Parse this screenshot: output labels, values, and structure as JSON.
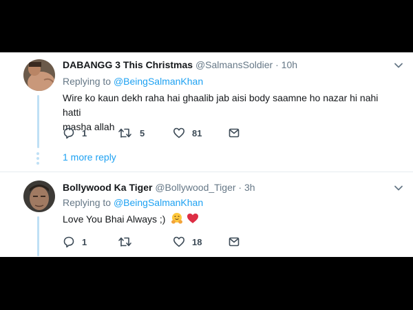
{
  "tweets": [
    {
      "name": "DABANGG 3 This Christmas",
      "handle": "@SalmansSoldier",
      "separator": "·",
      "time": "10h",
      "replying_prefix": "Replying to",
      "replying_to": "@BeingSalmanKhan",
      "text_line1": "Wire ko kaun dekh raha hai ghaalib jab aisi body saamne ho nazar hi nahi hatti",
      "text_line2": "masha allah",
      "replies": "1",
      "retweets": "5",
      "likes": "81",
      "more_replies": "1 more reply",
      "icons": [
        "chevron-down-icon",
        "reply-icon",
        "retweet-icon",
        "like-icon",
        "share-icon"
      ]
    },
    {
      "name": "Bollywood Ka Tiger",
      "handle": "@Bollywood_Tiger",
      "separator": "·",
      "time": "3h",
      "replying_prefix": "Replying to",
      "replying_to": "@BeingSalmanKhan",
      "text": "Love You Bhai Always ;)",
      "replies": "1",
      "retweets": "",
      "likes": "18",
      "icons": [
        "chevron-down-icon",
        "reply-icon",
        "retweet-icon",
        "like-icon",
        "share-icon",
        "hugging-face-emoji",
        "red-heart-emoji"
      ]
    }
  ],
  "colors": {
    "link": "#1da1f2",
    "muted": "#657786",
    "thread_line": "#bfe0f5",
    "background": "#000000",
    "panel": "#ffffff"
  }
}
